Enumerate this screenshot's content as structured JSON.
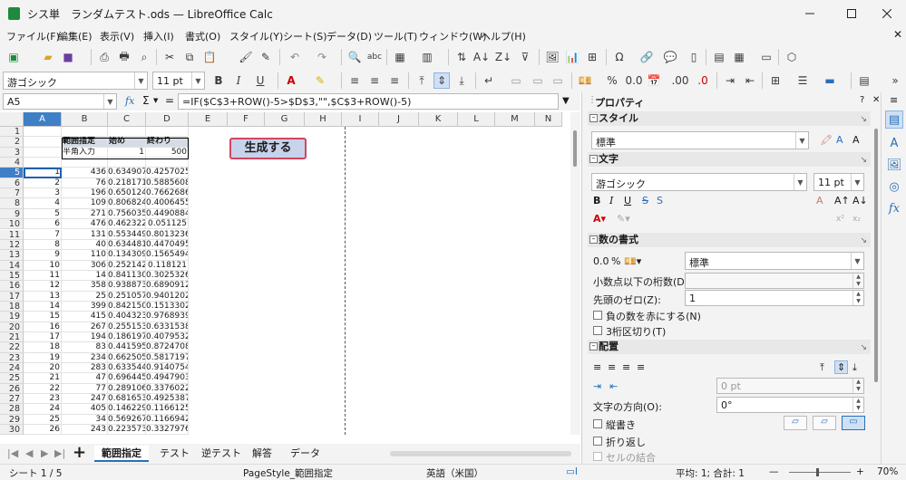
{
  "window": {
    "title": "シス単　ランダムテスト.ods — LibreOffice Calc",
    "app_icon": "calc-icon"
  },
  "menu": [
    "ファイル(F)",
    "編集(E)",
    "表示(V)",
    "挿入(I)",
    "書式(O)",
    "スタイル(Y)",
    "シート(S)",
    "データ(D)",
    "ツール(T)",
    "ウィンドウ(W)",
    "ヘルプ(H)"
  ],
  "format_toolbar": {
    "font_name": "游ゴシック",
    "font_size": "11 pt",
    "bold": "B",
    "italic": "I",
    "underline": "U",
    "percent": "%",
    "number_format": "0.0",
    "decimal_add": ".00",
    "decimal_remove": ".0"
  },
  "formula_bar": {
    "name_box": "A5",
    "fx": "fx",
    "sigma": "Σ",
    "equals": "=",
    "formula": "=IF($C$3+ROW()-5>$D$3,\"\",$C$3+ROW()-5)"
  },
  "grid": {
    "columns": [
      "A",
      "B",
      "C",
      "D",
      "E",
      "F",
      "G",
      "H",
      "I",
      "J",
      "K",
      "L",
      "M",
      "N"
    ],
    "header_cells": {
      "b2": "範囲指定",
      "c2": "始め",
      "d2": "終わり",
      "b3": "半角入力",
      "c3": "1",
      "d3": "500"
    },
    "generate_button": "生成する",
    "rows": [
      {
        "row": "1",
        "a": "",
        "b": "",
        "c": "",
        "d": ""
      },
      {
        "row": "2",
        "a": "",
        "b": "",
        "c": "",
        "d": ""
      },
      {
        "row": "3",
        "a": "",
        "b": "",
        "c": "",
        "d": ""
      },
      {
        "row": "4",
        "a": "",
        "b": "",
        "c": "",
        "d": ""
      },
      {
        "row": "5",
        "a": "1",
        "b": "436",
        "c": "0.6349077",
        "d": "0.4257025"
      },
      {
        "row": "6",
        "a": "2",
        "b": "76",
        "c": "0.2181713",
        "d": "0.5885608"
      },
      {
        "row": "7",
        "a": "3",
        "b": "196",
        "c": "0.6501243",
        "d": "0.7662686"
      },
      {
        "row": "8",
        "a": "4",
        "b": "109",
        "c": "0.8068245",
        "d": "0.4006455"
      },
      {
        "row": "9",
        "a": "5",
        "b": "271",
        "c": "0.7560359",
        "d": "0.4490884"
      },
      {
        "row": "10",
        "a": "6",
        "b": "476",
        "c": "0.4623229",
        "d": "0.051125"
      },
      {
        "row": "11",
        "a": "7",
        "b": "131",
        "c": "0.5534491",
        "d": "0.8013236"
      },
      {
        "row": "12",
        "a": "8",
        "b": "40",
        "c": "0.634481",
        "d": "0.4470495"
      },
      {
        "row": "13",
        "a": "9",
        "b": "110",
        "c": "0.1343098",
        "d": "0.1565494"
      },
      {
        "row": "14",
        "a": "10",
        "b": "306",
        "c": "0.2521422",
        "d": "0.118121"
      },
      {
        "row": "15",
        "a": "11",
        "b": "14",
        "c": "0.8411304",
        "d": "0.3025326"
      },
      {
        "row": "16",
        "a": "12",
        "b": "358",
        "c": "0.9388733",
        "d": "0.6890912"
      },
      {
        "row": "17",
        "a": "13",
        "b": "25",
        "c": "0.2510578",
        "d": "0.9401202"
      },
      {
        "row": "18",
        "a": "14",
        "b": "399",
        "c": "0.8421502",
        "d": "0.1513302"
      },
      {
        "row": "19",
        "a": "15",
        "b": "415",
        "c": "0.4043239",
        "d": "0.9768939"
      },
      {
        "row": "20",
        "a": "16",
        "b": "267",
        "c": "0.2551531",
        "d": "0.6331538"
      },
      {
        "row": "21",
        "a": "17",
        "b": "194",
        "c": "0.186197",
        "d": "0.4079532"
      },
      {
        "row": "22",
        "a": "18",
        "b": "83",
        "c": "0.4415952",
        "d": "0.8724708"
      },
      {
        "row": "23",
        "a": "19",
        "b": "234",
        "c": "0.6625056",
        "d": "0.5817197"
      },
      {
        "row": "24",
        "a": "20",
        "b": "283",
        "c": "0.6335449",
        "d": "0.9140754"
      },
      {
        "row": "25",
        "a": "21",
        "b": "47",
        "c": "0.6964453",
        "d": "0.4947903"
      },
      {
        "row": "26",
        "a": "22",
        "b": "77",
        "c": "0.2891064",
        "d": "0.3376022"
      },
      {
        "row": "27",
        "a": "23",
        "b": "247",
        "c": "0.6816535",
        "d": "0.4925387"
      },
      {
        "row": "28",
        "a": "24",
        "b": "405",
        "c": "0.1462299",
        "d": "0.1166125"
      },
      {
        "row": "29",
        "a": "25",
        "b": "34",
        "c": "0.5692672",
        "d": "0.1166942"
      },
      {
        "row": "30",
        "a": "26",
        "b": "243",
        "c": "0.2235739",
        "d": "0.3327976"
      }
    ]
  },
  "sheet_tabs": [
    "範囲指定",
    "テスト",
    "逆テスト",
    "解答",
    "データ"
  ],
  "status_bar": {
    "sheet": "シート 1 / 5",
    "page_style": "PageStyle_範囲指定",
    "language": "英語（米国）",
    "summary": "平均: 1; 合計: 1",
    "zoom": "70%"
  },
  "sidebar": {
    "title": "プロパティ",
    "style_section": "スタイル",
    "style_value": "標準",
    "char_section": "文字",
    "font_name": "游ゴシック",
    "font_size": "11 pt",
    "numfmt_section": "数の書式",
    "numfmt_value": "標準",
    "decimal_places_label": "小数点以下の桁数(D):",
    "leading_zero_label": "先頭のゼロ(Z):",
    "leading_zero_value": "1",
    "negative_red_label": "負の数を赤にする(N)",
    "thousands_sep_label": "3桁区切り(T)",
    "align_section": "配置",
    "indent_value": "0 pt",
    "text_direction_label": "文字の方向(O):",
    "text_direction_value": "0°",
    "vertical_label": "縦書き",
    "wrap_label": "折り返し",
    "merge_label": "セルの結合"
  }
}
